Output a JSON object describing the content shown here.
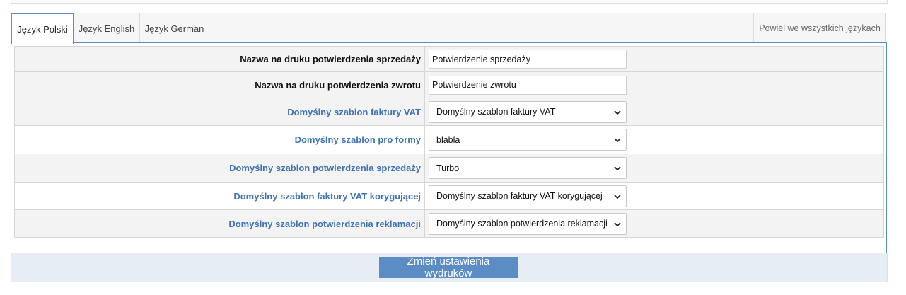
{
  "tabs": [
    {
      "label": "Język Polski",
      "active": true
    },
    {
      "label": "Język English",
      "active": false
    },
    {
      "label": "Język German",
      "active": false
    }
  ],
  "copy_all_label": "Powiel we wszystkich językach",
  "rows": [
    {
      "label": "Nazwa na druku potwierdzenia sprzedaży",
      "type": "text",
      "value": "Potwierdzenie sprzedaży"
    },
    {
      "label": "Nazwa na druku potwierdzenia zwrotu",
      "type": "text",
      "value": "Potwierdzenie zwrotu"
    },
    {
      "label": "Domyślny szablon faktury VAT",
      "type": "select",
      "value": "Domyślny szablon faktury VAT"
    },
    {
      "label": "Domyślny szablon pro formy",
      "type": "select",
      "value": "blabla"
    },
    {
      "label": "Domyślny szablon potwierdzenia sprzedaży",
      "type": "select",
      "value": "Turbo"
    },
    {
      "label": "Domyślny szablon faktury VAT korygującej",
      "type": "select",
      "value": "Domyślny szablon faktury VAT korygującej"
    },
    {
      "label": "Domyślny szablon potwierdzenia reklamacji",
      "type": "select",
      "value": "Domyślny szablon potwierdzenia reklamacji"
    }
  ],
  "submit_label": "Zmień ustawienia wydruków",
  "colors": {
    "accent": "#5b8cc4",
    "label_blue": "#3f73b3"
  },
  "icons": {
    "select_arrow": "chevron-down-icon"
  }
}
